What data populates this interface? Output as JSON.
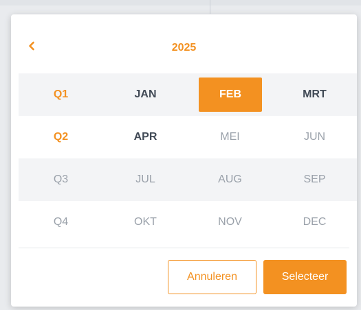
{
  "header": {
    "year": "2025",
    "prev_icon": "chevron-left-icon"
  },
  "rows": [
    {
      "quarter": "Q1",
      "months": [
        "JAN",
        "FEB",
        "MRT"
      ]
    },
    {
      "quarter": "Q2",
      "months": [
        "APR",
        "MEI",
        "JUN"
      ]
    },
    {
      "quarter": "Q3",
      "months": [
        "JUL",
        "AUG",
        "SEP"
      ]
    },
    {
      "quarter": "Q4",
      "months": [
        "OKT",
        "NOV",
        "DEC"
      ]
    }
  ],
  "selected_month": "FEB",
  "footer": {
    "cancel_label": "Annuleren",
    "select_label": "Selecteer"
  },
  "colors": {
    "accent": "#f39121",
    "text_enabled": "#414a56",
    "text_disabled": "#9aa1aa",
    "row_shade": "#f3f4f6"
  }
}
